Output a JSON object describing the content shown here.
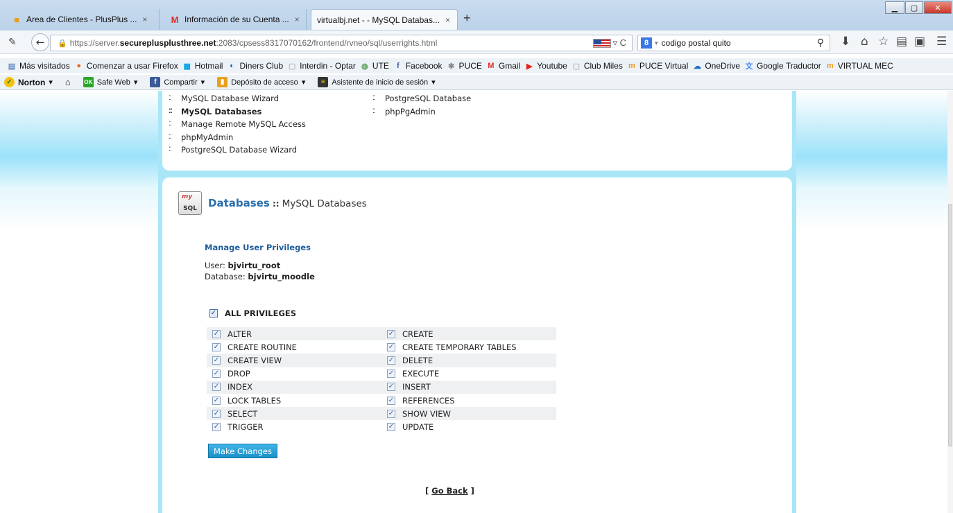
{
  "tabs": [
    {
      "title": "Area de Clientes - PlusPlus ...",
      "icon": "folder-icon",
      "close": "×"
    },
    {
      "title": "Información de su Cuenta ...",
      "icon": "gmail-icon",
      "close": "×"
    },
    {
      "title": "virtualbj.net - - MySQL Databas...",
      "icon": "page-icon",
      "close": "×",
      "active": true
    }
  ],
  "new_tab": "+",
  "url": {
    "prefix": "https://server.",
    "domain": "securepluspl usthree.net",
    "domain_text": "securepluspl",
    "domain_bold": "securepluspl usthree.net",
    "host": "secureplusplusthree.net",
    "suffix": ":2083/cpsess8317070162/frontend/rvneo/sql/userrights.html"
  },
  "search": {
    "value": "codigo postal quito",
    "engine": "8"
  },
  "bookmarks": [
    {
      "label": "Más visitados",
      "icon": "page-icon",
      "color": "#6a8fc8"
    },
    {
      "label": "Comenzar a usar Firefox",
      "icon": "firefox-icon",
      "color": "#e66a1f"
    },
    {
      "label": "Hotmail",
      "icon": "windows-icon",
      "color": "#00a4ef"
    },
    {
      "label": "Diners Club",
      "icon": "diners-icon",
      "color": "#1d59b8"
    },
    {
      "label": "Interdin - Optar",
      "icon": "blank-page-icon",
      "color": "#bbbbbb"
    },
    {
      "label": "UTE",
      "icon": "globe-icon",
      "color": "#5aa05a"
    },
    {
      "label": "Facebook",
      "icon": "facebook-icon",
      "color": "#3b5998"
    },
    {
      "label": "PUCE",
      "icon": "puce-icon",
      "color": "#888888"
    },
    {
      "label": "Gmail",
      "icon": "gmail-icon",
      "color": "#d93025"
    },
    {
      "label": "Youtube",
      "icon": "youtube-icon",
      "color": "#e62117"
    },
    {
      "label": "Club Miles",
      "icon": "blank-page-icon",
      "color": "#bbbbbb"
    },
    {
      "label": "PUCE Virtual",
      "icon": "moodle-icon",
      "color": "#f39a1b"
    },
    {
      "label": "OneDrive",
      "icon": "cloud-icon",
      "color": "#1b6ac9"
    },
    {
      "label": "Google Traductor",
      "icon": "translate-icon",
      "color": "#4a8af4"
    },
    {
      "label": "VIRTUAL MEC",
      "icon": "moodle-icon",
      "color": "#f39a1b"
    }
  ],
  "norton_bar": {
    "brand": "Norton",
    "safe_web": "Safe Web",
    "share": "Compartir",
    "vault": "Depósito de acceso",
    "login": "Asistente de inicio de sesión"
  },
  "top_links": {
    "left": [
      {
        "label": "MySQL Database Wizard",
        "current": false
      },
      {
        "label": "MySQL Databases",
        "current": true
      },
      {
        "label": "Manage Remote MySQL Access",
        "current": false
      },
      {
        "label": "phpMyAdmin",
        "current": false
      },
      {
        "label": "PostgreSQL Database Wizard",
        "current": false
      }
    ],
    "right": [
      {
        "label": "PostgreSQL Database"
      },
      {
        "label": "phpPgAdmin"
      }
    ]
  },
  "heading": {
    "crumb": "Databases",
    "separator": " :: ",
    "page": "MySQL Databases",
    "icon_text": "SQL"
  },
  "manage": {
    "title": "Manage User Privileges",
    "user_label": "User:",
    "user_value": "bjvirtu_root",
    "db_label": "Database:",
    "db_value": "bjvirtu_moodle"
  },
  "all_privileges": {
    "label": "ALL PRIVILEGES",
    "checked": true
  },
  "privileges": [
    [
      "ALTER",
      "CREATE"
    ],
    [
      "CREATE ROUTINE",
      "CREATE TEMPORARY TABLES"
    ],
    [
      "CREATE VIEW",
      "DELETE"
    ],
    [
      "DROP",
      "EXECUTE"
    ],
    [
      "INDEX",
      "INSERT"
    ],
    [
      "LOCK TABLES",
      "REFERENCES"
    ],
    [
      "SELECT",
      "SHOW VIEW"
    ],
    [
      "TRIGGER",
      "UPDATE"
    ]
  ],
  "make_changes": "Make Changes",
  "go_back": {
    "open": "[ ",
    "label": "Go Back",
    "close": " ]"
  },
  "colors": {
    "accent": "#2a6fad",
    "button": "#1b8fc7",
    "panel_bg": "#a9e6f8"
  }
}
